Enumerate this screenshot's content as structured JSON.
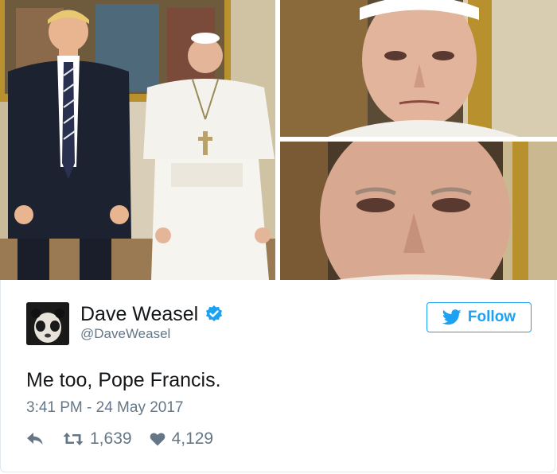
{
  "tweet": {
    "author": {
      "display_name": "Dave Weasel",
      "handle": "@DaveWeasel",
      "verified": true,
      "avatar_icon": "panda-face-avatar"
    },
    "follow_label": "Follow",
    "text": "Me too, Pope Francis.",
    "timestamp": "3:41 PM - 24 May 2017",
    "stats": {
      "retweets": "1,639",
      "likes": "4,129"
    },
    "icons": {
      "reply": "reply-icon",
      "retweet": "retweet-icon",
      "like": "heart-icon",
      "bird": "twitter-bird-icon",
      "verified": "verified-badge-icon"
    }
  },
  "colors": {
    "brand_blue": "#1da1f2",
    "text_primary": "#14171a",
    "text_secondary": "#657786",
    "border": "#e1e8ed"
  }
}
